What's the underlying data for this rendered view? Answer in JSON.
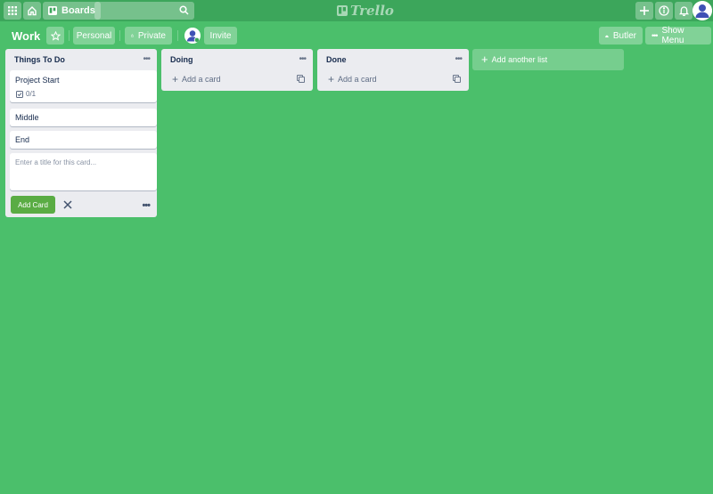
{
  "app": {
    "logo_text": "Trello"
  },
  "topbar": {
    "boards_label": "Boards",
    "search_value": ""
  },
  "board": {
    "title": "Work",
    "team_label": "Personal",
    "visibility_label": "Private",
    "invite_label": "Invite",
    "butler_label": "Butler",
    "menu_label": "Show Menu"
  },
  "lists": [
    {
      "title": "Things To Do",
      "cards": [
        {
          "title": "Project Start",
          "checklist": "0/1"
        },
        {
          "title": "Middle"
        },
        {
          "title": "End"
        }
      ],
      "composer": {
        "placeholder": "Enter a title for this card...",
        "value": "",
        "submit_label": "Add Card"
      }
    },
    {
      "title": "Doing",
      "add_card_label": "Add a card"
    },
    {
      "title": "Done",
      "add_card_label": "Add a card"
    }
  ],
  "add_list_label": "Add another list",
  "colors": {
    "board_bg": "#4bbf6b",
    "header_bg": "#3ca65b",
    "add_card_btn": "#5aac44"
  }
}
